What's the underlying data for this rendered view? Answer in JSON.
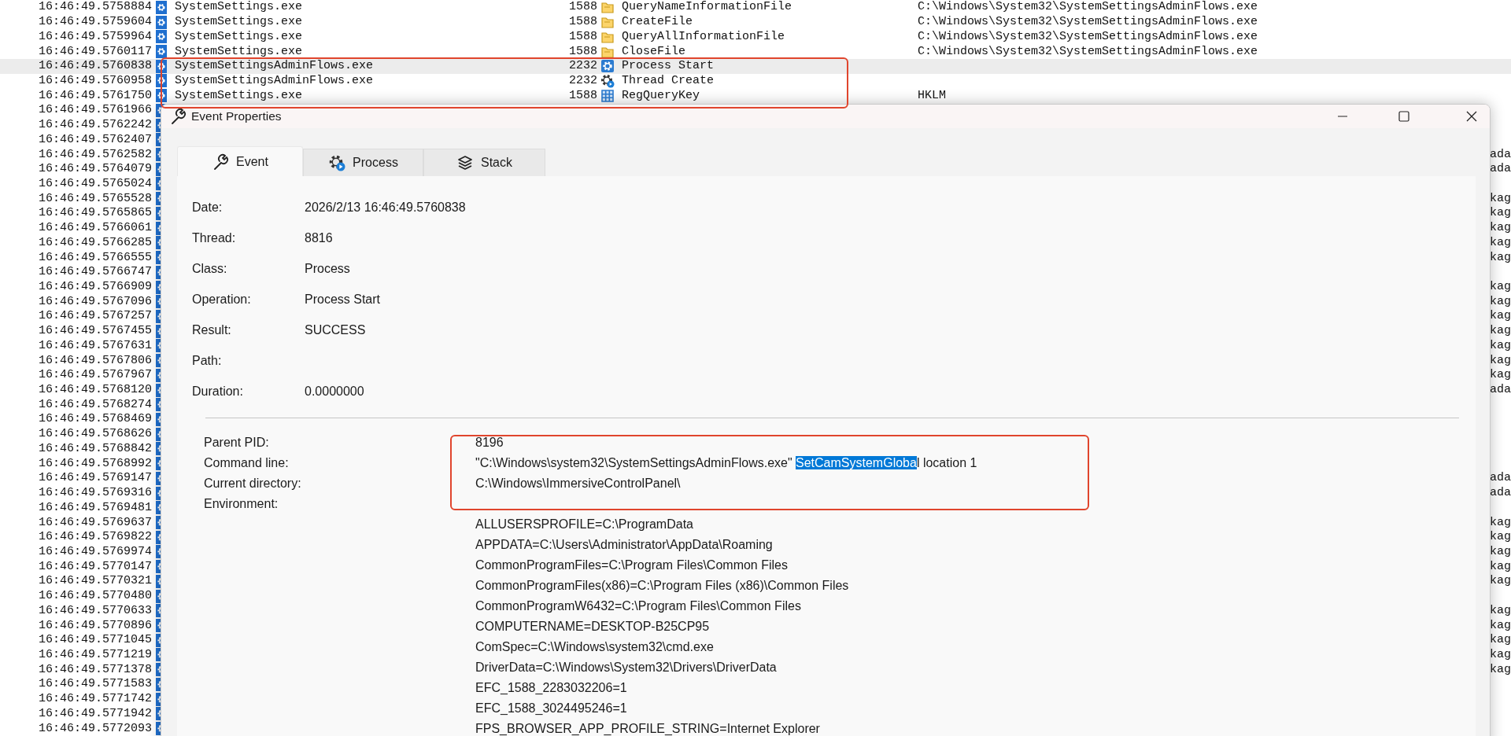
{
  "event_list": {
    "rows": [
      {
        "time": "16:46:49.5758884",
        "process": "SystemSettings.exe",
        "pid": "1588",
        "operation": "QueryNameInformationFile",
        "kind": "file",
        "path": "C:\\Windows\\System32\\SystemSettingsAdminFlows.exe",
        "selected": false
      },
      {
        "time": "16:46:49.5759604",
        "process": "SystemSettings.exe",
        "pid": "1588",
        "operation": "CreateFile",
        "kind": "file",
        "path": "C:\\Windows\\System32\\SystemSettingsAdminFlows.exe",
        "selected": false
      },
      {
        "time": "16:46:49.5759964",
        "process": "SystemSettings.exe",
        "pid": "1588",
        "operation": "QueryAllInformationFile",
        "kind": "file",
        "path": "C:\\Windows\\System32\\SystemSettingsAdminFlows.exe",
        "selected": false
      },
      {
        "time": "16:46:49.5760117",
        "process": "SystemSettings.exe",
        "pid": "1588",
        "operation": "CloseFile",
        "kind": "file",
        "path": "C:\\Windows\\System32\\SystemSettingsAdminFlows.exe",
        "selected": false
      },
      {
        "time": "16:46:49.5760838",
        "process": "SystemSettingsAdminFlows.exe",
        "pid": "2232",
        "operation": "Process Start",
        "kind": "process",
        "selected": true
      },
      {
        "time": "16:46:49.5760958",
        "process": "SystemSettingsAdminFlows.exe",
        "pid": "2232",
        "operation": "Thread Create",
        "kind": "thread",
        "selected": false
      },
      {
        "time": "16:46:49.5761750",
        "process": "SystemSettings.exe",
        "pid": "1588",
        "operation": "RegQueryKey",
        "kind": "registry",
        "path": "HKLM",
        "selected": false
      },
      {
        "time": "16:46:49.5761966",
        "selected": false
      },
      {
        "time": "16:46:49.5762242",
        "selected": false
      },
      {
        "time": "16:46:49.5762407",
        "selected": false
      },
      {
        "time": "16:46:49.5762582",
        "detail": "ada",
        "selected": false
      },
      {
        "time": "16:46:49.5764079",
        "detail": "ada",
        "selected": false
      },
      {
        "time": "16:46:49.5765024",
        "selected": false
      },
      {
        "time": "16:46:49.5765528",
        "detail": "kag",
        "selected": false
      },
      {
        "time": "16:46:49.5765865",
        "detail": "kag",
        "selected": false
      },
      {
        "time": "16:46:49.5766061",
        "detail": "kag",
        "selected": false
      },
      {
        "time": "16:46:49.5766285",
        "detail": "kag",
        "selected": false
      },
      {
        "time": "16:46:49.5766555",
        "detail": "kag",
        "selected": false
      },
      {
        "time": "16:46:49.5766747",
        "selected": false
      },
      {
        "time": "16:46:49.5766909",
        "detail": "kag",
        "selected": false
      },
      {
        "time": "16:46:49.5767096",
        "detail": "kag",
        "selected": false
      },
      {
        "time": "16:46:49.5767257",
        "detail": "kag",
        "selected": false
      },
      {
        "time": "16:46:49.5767455",
        "detail": "kag",
        "selected": false
      },
      {
        "time": "16:46:49.5767631",
        "detail": "kag",
        "selected": false
      },
      {
        "time": "16:46:49.5767806",
        "detail": "kag",
        "selected": false
      },
      {
        "time": "16:46:49.5767967",
        "detail": "kag",
        "selected": false
      },
      {
        "time": "16:46:49.5768120",
        "detail": "ada",
        "selected": false
      },
      {
        "time": "16:46:49.5768274",
        "selected": false
      },
      {
        "time": "16:46:49.5768469",
        "selected": false
      },
      {
        "time": "16:46:49.5768626",
        "selected": false
      },
      {
        "time": "16:46:49.5768842",
        "selected": false
      },
      {
        "time": "16:46:49.5768992",
        "selected": false
      },
      {
        "time": "16:46:49.5769147",
        "detail": "ada",
        "selected": false
      },
      {
        "time": "16:46:49.5769316",
        "detail": "ada",
        "selected": false
      },
      {
        "time": "16:46:49.5769481",
        "selected": false
      },
      {
        "time": "16:46:49.5769637",
        "detail": "kag",
        "selected": false
      },
      {
        "time": "16:46:49.5769822",
        "detail": "kag",
        "selected": false
      },
      {
        "time": "16:46:49.5769974",
        "detail": "kag",
        "selected": false
      },
      {
        "time": "16:46:49.5770147",
        "detail": "kag",
        "selected": false
      },
      {
        "time": "16:46:49.5770321",
        "detail": "kag",
        "selected": false
      },
      {
        "time": "16:46:49.5770480",
        "selected": false
      },
      {
        "time": "16:46:49.5770633",
        "detail": "kag",
        "selected": false
      },
      {
        "time": "16:46:49.5770896",
        "detail": "kag",
        "selected": false
      },
      {
        "time": "16:46:49.5771045",
        "detail": "kag",
        "selected": false
      },
      {
        "time": "16:46:49.5771219",
        "detail": "kag",
        "selected": false
      },
      {
        "time": "16:46:49.5771378",
        "detail": "kag",
        "selected": false
      },
      {
        "time": "16:46:49.5771583",
        "selected": false
      },
      {
        "time": "16:46:49.5771742",
        "selected": false
      },
      {
        "time": "16:46:49.5771942",
        "selected": false
      },
      {
        "time": "16:46:49.5772093",
        "selected": false
      }
    ]
  },
  "dialog": {
    "title": "Event Properties",
    "tabs": [
      {
        "label": "Event",
        "kind": "event",
        "selected": true
      },
      {
        "label": "Process",
        "kind": "process",
        "selected": false
      },
      {
        "label": "Stack",
        "kind": "stack",
        "selected": false
      }
    ],
    "fields": [
      {
        "label": "Date:",
        "value": "2026/2/13 16:46:49.5760838"
      },
      {
        "label": "Thread:",
        "value": "8816"
      },
      {
        "label": "Class:",
        "value": "Process"
      },
      {
        "label": "Operation:",
        "value": "Process Start"
      },
      {
        "label": "Result:",
        "value": "SUCCESS"
      },
      {
        "label": "Path:"
      },
      {
        "label": "Duration:",
        "value": "0.0000000"
      }
    ],
    "details": [
      {
        "label": "Parent PID:",
        "parts": [
          {
            "text": "8196",
            "selected": false
          }
        ]
      },
      {
        "label": "Command line:",
        "parts": [
          {
            "text": "\"C:\\Windows\\system32\\SystemSettingsAdminFlows.exe\" ",
            "selected": false
          },
          {
            "text": "SetCamSystemGloba",
            "selected": true
          },
          {
            "text": "l location 1",
            "selected": false
          }
        ]
      },
      {
        "label": "Current directory:",
        "parts": [
          {
            "text": "C:\\Windows\\ImmersiveControlPanel\\",
            "selected": false
          }
        ]
      },
      {
        "label": "Environment:"
      }
    ],
    "environment": [
      "ALLUSERSPROFILE=C:\\ProgramData",
      "APPDATA=C:\\Users\\Administrator\\AppData\\Roaming",
      "CommonProgramFiles=C:\\Program Files\\Common Files",
      "CommonProgramFiles(x86)=C:\\Program Files (x86)\\Common Files",
      "CommonProgramW6432=C:\\Program Files\\Common Files",
      "COMPUTERNAME=DESKTOP-B25CP95",
      "ComSpec=C:\\Windows\\system32\\cmd.exe",
      "DriverData=C:\\Windows\\System32\\Drivers\\DriverData",
      "EFC_1588_2283032206=1",
      "EFC_1588_3024495246=1",
      "FPS_BROWSER_APP_PROFILE_STRING=Internet Explorer"
    ]
  }
}
